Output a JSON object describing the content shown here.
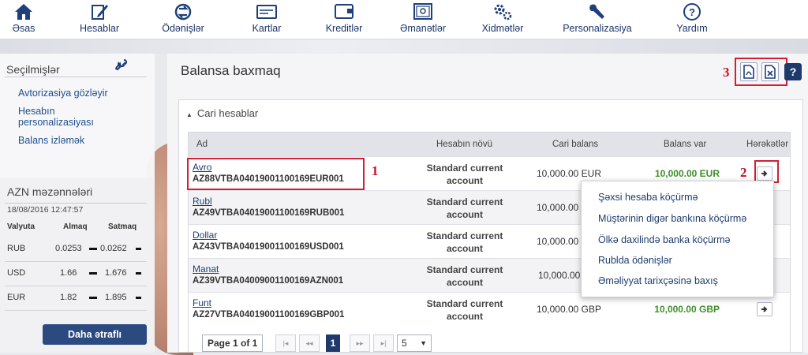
{
  "nav": {
    "items": [
      {
        "label": "Əsas",
        "icon": "home-icon"
      },
      {
        "label": "Hesablar",
        "icon": "edit-icon"
      },
      {
        "label": "Ödənişlər",
        "icon": "transfer-icon"
      },
      {
        "label": "Kartlar",
        "icon": "card-icon"
      },
      {
        "label": "Kreditlər",
        "icon": "wallet-icon"
      },
      {
        "label": "Əmanətlər",
        "icon": "safe-icon"
      },
      {
        "label": "Xidmətlər",
        "icon": "gears-icon"
      },
      {
        "label": "Personalizasiya",
        "icon": "wrench-icon"
      },
      {
        "label": "Yardım",
        "icon": "help-icon"
      }
    ]
  },
  "sidebar": {
    "title": "Seçilmişlər",
    "links": [
      "Avtorizasiya gözləyir",
      "Hesabın personalizasiyası",
      "Balans izləmək"
    ],
    "rates": {
      "title": "AZN məzənnələri",
      "date": "18/08/2016 12:47:57",
      "headers": {
        "currency": "Valyuta",
        "buy": "Almaq",
        "sell": "Satmaq"
      },
      "rows": [
        {
          "currency": "RUB",
          "buy": "0.0253",
          "sell": "0.0262"
        },
        {
          "currency": "USD",
          "buy": "1.66",
          "sell": "1.676"
        },
        {
          "currency": "EUR",
          "buy": "1.82",
          "sell": "1.895"
        }
      ],
      "more_label": "Daha ətraflı"
    }
  },
  "main": {
    "title": "Balansa baxmaq",
    "annotations": [
      "1",
      "2",
      "3"
    ],
    "help_label": "?",
    "panel_title": "Cari hesablar",
    "columns": {
      "name": "Ad",
      "type": "Hesabın növü",
      "balance": "Cari balans",
      "available": "Balans var",
      "actions": "Hərəkətlər"
    },
    "accounts": [
      {
        "name": "Avro",
        "iban": "AZ88VTBA04019001100169EUR001",
        "type": "Standard current account",
        "balance": "10,000.00 EUR",
        "available": "10,000.00 EUR"
      },
      {
        "name": "Rubl",
        "iban": "AZ49VTBA04019001100169RUB001",
        "type": "Standard current account",
        "balance": "10,000.00 RUB",
        "available": ""
      },
      {
        "name": "Dollar",
        "iban": "AZ43VTBA04019001100169USD001",
        "type": "Standard current account",
        "balance": "10,000.00 USD",
        "available": ""
      },
      {
        "name": "Manat",
        "iban": "AZ39VTBA04009001100169AZN001",
        "type": "Standard current account",
        "balance": "10,000.00 AZN",
        "available": ""
      },
      {
        "name": "Funt",
        "iban": "AZ27VTBA04019001100169GBP001",
        "type": "Standard current account",
        "balance": "10,000.00 GBP",
        "available": "10,000.00 GBP"
      }
    ],
    "pager": {
      "label": "Page 1 of 1",
      "current": "1",
      "page_size": "5"
    },
    "action_menu": [
      "Şəxsi hesaba köçürmə",
      "Müştərinin digər bankına köçürmə",
      "Ölkə daxilində banka köçürmə",
      "Rublda ödənişlər",
      "Əməliyyat tarixçəsinə baxış"
    ]
  }
}
